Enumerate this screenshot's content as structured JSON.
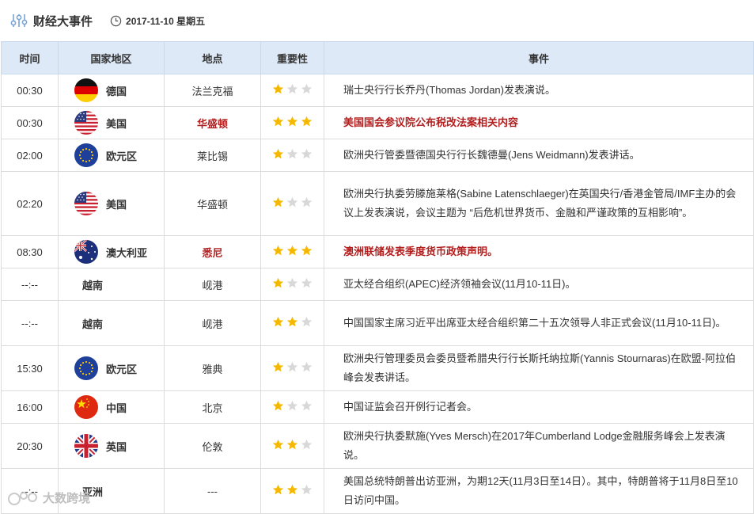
{
  "header": {
    "title": "财经大事件",
    "date": "2017-11-10 星期五"
  },
  "table": {
    "columns": [
      "时间",
      "国家地区",
      "地点",
      "重要性",
      "事件"
    ],
    "rows": [
      {
        "time": "00:30",
        "country": "德国",
        "flag": "germany-flag",
        "location": "法兰克福",
        "stars": 1,
        "event": "瑞士央行行长乔丹(Thomas Jordan)发表演说。",
        "highlight": false
      },
      {
        "time": "00:30",
        "country": "美国",
        "flag": "usa-flag",
        "location": "华盛顿",
        "stars": 3,
        "event": "美国国会参议院公布税改法案相关内容",
        "highlight": true
      },
      {
        "time": "02:00",
        "country": "欧元区",
        "flag": "eu-flag",
        "location": "莱比锡",
        "stars": 1,
        "event": "欧洲央行管委暨德国央行行长魏德曼(Jens Weidmann)发表讲话。",
        "highlight": false
      },
      {
        "time": "02:20",
        "country": "美国",
        "flag": "usa-flag",
        "location": "华盛顿",
        "stars": 1,
        "event": "欧洲央行执委劳滕施莱格(Sabine Latenschlaeger)在英国央行/香港金管局/IMF主办的会议上发表演说，会议主题为 “后危机世界货币、金融和严谨政策的互相影响”。",
        "highlight": false
      },
      {
        "time": "08:30",
        "country": "澳大利亚",
        "flag": "australia-flag",
        "location": "悉尼",
        "stars": 3,
        "event": "澳洲联储发表季度货币政策声明。",
        "highlight": true
      },
      {
        "time": "--:--",
        "country": "越南",
        "flag": "",
        "location": "岘港",
        "stars": 1,
        "event": "亚太经合组织(APEC)经济领袖会议(11月10-11日)。",
        "highlight": false
      },
      {
        "time": "--:--",
        "country": "越南",
        "flag": "",
        "location": "岘港",
        "stars": 2,
        "event": "中国国家主席习近平出席亚太经合组织第二十五次领导人非正式会议(11月10-11日)。",
        "highlight": false
      },
      {
        "time": "15:30",
        "country": "欧元区",
        "flag": "eu-flag",
        "location": "雅典",
        "stars": 1,
        "event": "欧洲央行管理委员会委员暨希腊央行行长斯托纳拉斯(Yannis Stournaras)在欧盟-阿拉伯峰会发表讲话。",
        "highlight": false
      },
      {
        "time": "16:00",
        "country": "中国",
        "flag": "china-flag",
        "location": "北京",
        "stars": 1,
        "event": "中国证监会召开例行记者会。",
        "highlight": false
      },
      {
        "time": "20:30",
        "country": "英国",
        "flag": "uk-flag",
        "location": "伦敦",
        "stars": 2,
        "event": "欧洲央行执委默施(Yves Mersch)在2017年Cumberland Lodge金融服务峰会上发表演说。",
        "highlight": false
      },
      {
        "time": "--:--",
        "country": "亚洲",
        "flag": "",
        "location": "---",
        "stars": 2,
        "event": "美国总统特朗普出访亚洲，为期12天(11月3日至14日）。其中，特朗普将于11月8日至10日访问中国。",
        "highlight": false
      }
    ]
  },
  "watermark": {
    "text": "大数跨境"
  },
  "colors": {
    "header_bg": "#dde9f7",
    "star_on": "#f5b800",
    "star_off": "#d8d8d8",
    "highlight_text": "#b21f1f"
  }
}
